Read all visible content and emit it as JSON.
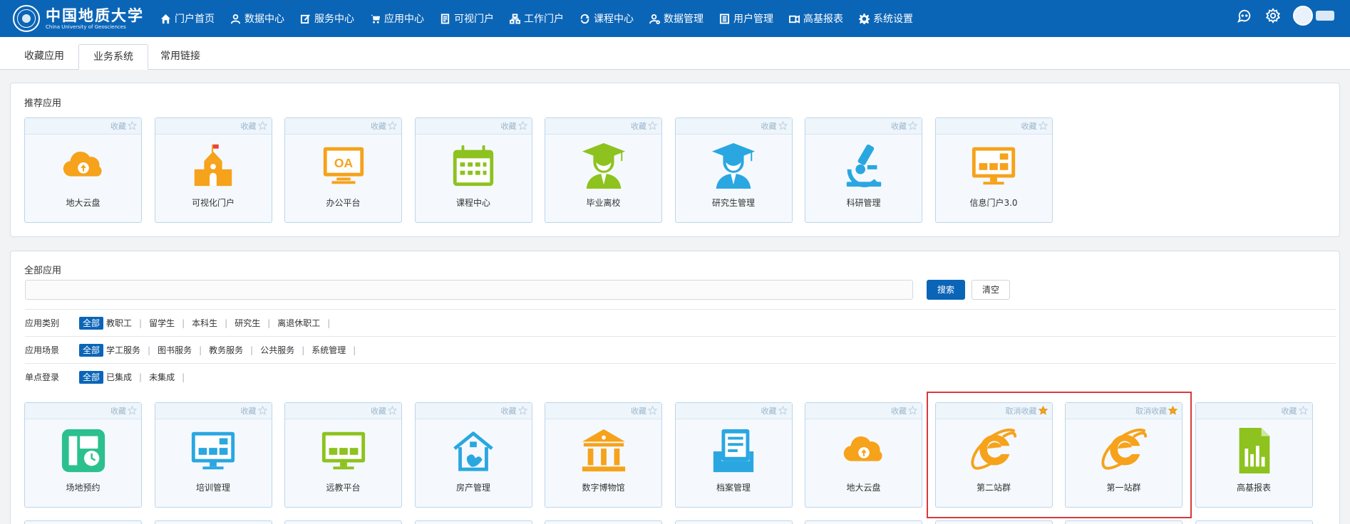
{
  "header": {
    "logo": {
      "name_cn": "中国地质大学",
      "name_en": "China University of Geosciences"
    },
    "nav": [
      {
        "label": "门户首页",
        "icon": "home-icon"
      },
      {
        "label": "数据中心",
        "icon": "user-icon"
      },
      {
        "label": "服务中心",
        "icon": "edit-icon"
      },
      {
        "label": "应用中心",
        "icon": "cart-icon"
      },
      {
        "label": "可视门户",
        "icon": "document-icon"
      },
      {
        "label": "工作门户",
        "icon": "org-chart-icon"
      },
      {
        "label": "课程中心",
        "icon": "sync-icon"
      },
      {
        "label": "数据管理",
        "icon": "user-gear-icon"
      },
      {
        "label": "用户管理",
        "icon": "list-icon"
      },
      {
        "label": "高基报表",
        "icon": "report-icon"
      },
      {
        "label": "系统设置",
        "icon": "gear-icon"
      }
    ]
  },
  "tabs": [
    "收藏应用",
    "业务系统",
    "常用链接"
  ],
  "recommended": {
    "title": "推荐应用",
    "fav_label": "收藏",
    "apps": [
      {
        "label": "地大云盘",
        "icon": "cloud-upload-icon",
        "color": "#f6a21b"
      },
      {
        "label": "可视化门户",
        "icon": "school-building-icon",
        "color": "#f6a21b"
      },
      {
        "label": "办公平台",
        "icon": "oa-monitor-icon",
        "color": "#f6a21b",
        "text": "OA"
      },
      {
        "label": "课程中心",
        "icon": "calendar-icon",
        "color": "#8dc21f"
      },
      {
        "label": "毕业离校",
        "icon": "graduate-icon",
        "color": "#8dc21f"
      },
      {
        "label": "研究生管理",
        "icon": "graduate-icon",
        "color": "#2aa7e1"
      },
      {
        "label": "科研管理",
        "icon": "microscope-icon",
        "color": "#2aa7e1"
      },
      {
        "label": "信息门户3.0",
        "icon": "dashboard-monitor-icon",
        "color": "#f6a21b"
      }
    ]
  },
  "all_apps": {
    "title": "全部应用",
    "search": {
      "placeholder": "",
      "search_label": "搜索",
      "clear_label": "清空"
    },
    "filters": [
      {
        "label": "应用类别",
        "options": [
          "全部",
          "教职工",
          "留学生",
          "本科生",
          "研究生",
          "离退休职工"
        ]
      },
      {
        "label": "应用场景",
        "options": [
          "全部",
          "学工服务",
          "图书服务",
          "教务服务",
          "公共服务",
          "系统管理"
        ]
      },
      {
        "label": "单点登录",
        "options": [
          "全部",
          "已集成",
          "未集成"
        ]
      }
    ],
    "fav_label": "收藏",
    "unfav_label": "取消收藏",
    "apps": [
      {
        "label": "场地预约",
        "icon": "venue-booking-icon",
        "color": "#2cc08f",
        "favorited": false
      },
      {
        "label": "培训管理",
        "icon": "training-monitor-icon",
        "color": "#2aa7e1",
        "favorited": false
      },
      {
        "label": "远教平台",
        "icon": "remote-monitor-icon",
        "color": "#8dc21f",
        "favorited": false
      },
      {
        "label": "房产管理",
        "icon": "house-icon",
        "color": "#2aa7e1",
        "favorited": false
      },
      {
        "label": "数字博物馆",
        "icon": "museum-icon",
        "color": "#f6a21b",
        "favorited": false
      },
      {
        "label": "档案管理",
        "icon": "archive-icon",
        "color": "#2aa7e1",
        "favorited": false
      },
      {
        "label": "地大云盘",
        "icon": "cloud-upload-icon",
        "color": "#f6a21b",
        "favorited": false
      },
      {
        "label": "第二站群",
        "icon": "ie-browser-icon",
        "color": "#f6a21b",
        "favorited": true
      },
      {
        "label": "第一站群",
        "icon": "ie-browser-icon",
        "color": "#f6a21b",
        "favorited": true
      },
      {
        "label": "高基报表",
        "icon": "report-chart-icon",
        "color": "#8dc21f",
        "favorited": false
      }
    ]
  },
  "colors": {
    "brand": "#0b65b7",
    "highlight": "#d9393a",
    "star_active": "#f6a21b"
  }
}
